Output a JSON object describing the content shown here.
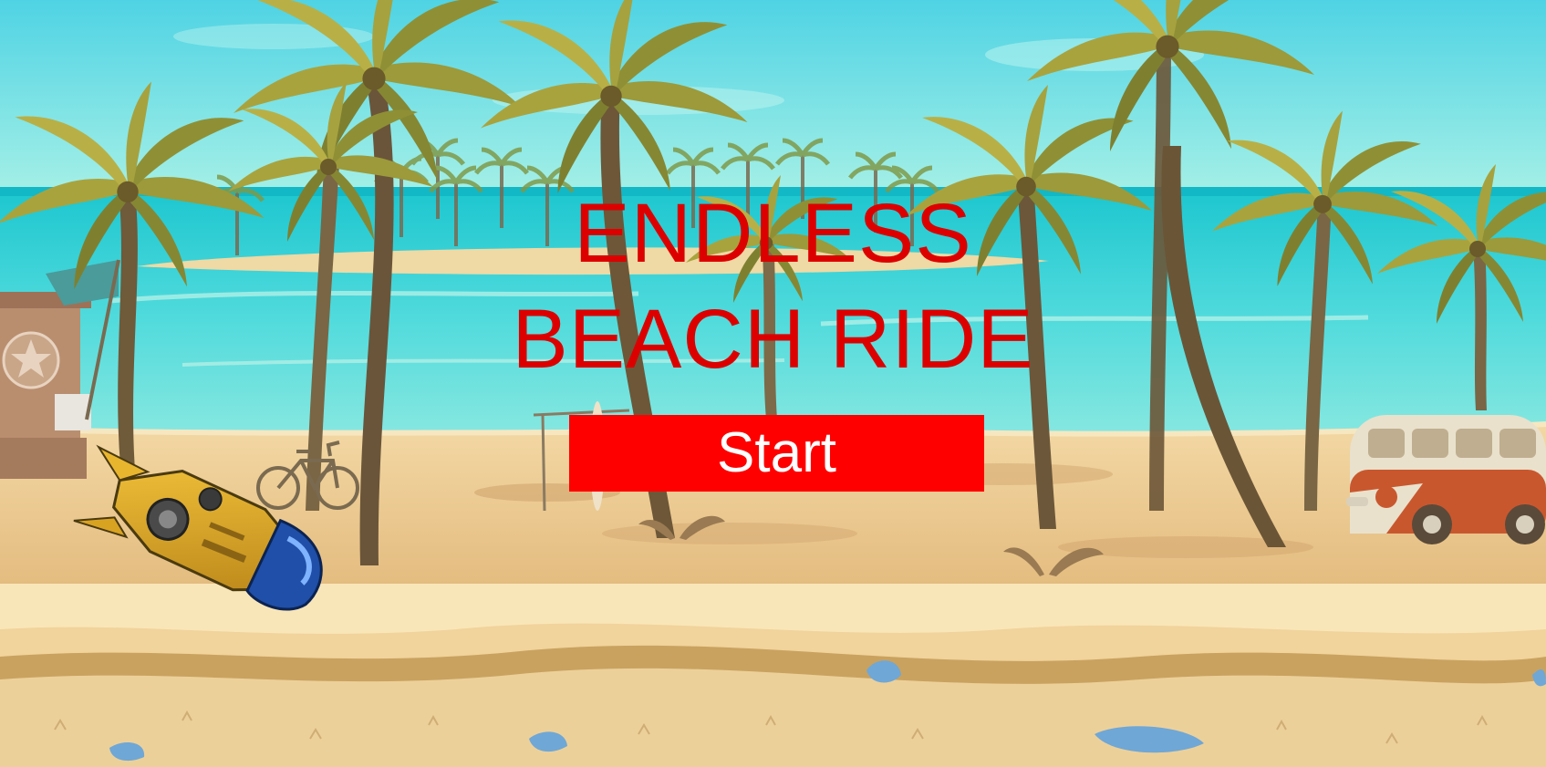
{
  "game": {
    "title_line_1": "ENDLESS",
    "title_line_2": "BEACH RIDE",
    "start_label": "Start"
  },
  "scene": {
    "setting": "tropical beach with palm trees, ocean, lifeguard hut, bicycle, surfboards, red camper van",
    "player_sprite": "yellow-spaceship-icon"
  },
  "colors": {
    "title": "#dd0000",
    "button_bg": "#ff0000",
    "button_text": "#ffffff",
    "sky": "#5fdde6",
    "sea": "#2fd0d6",
    "sand": "#f1d39c"
  }
}
